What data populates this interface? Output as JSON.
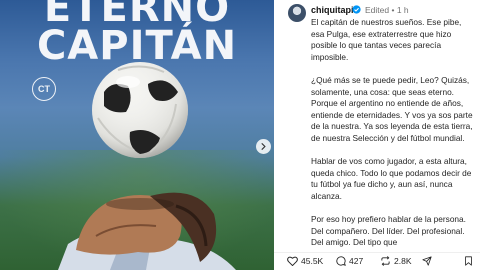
{
  "image": {
    "headline_line1": "ETERNO",
    "headline_line2": "CAPITÁN",
    "badge_text": "CT",
    "next_icon": "chevron-right-icon"
  },
  "post": {
    "username": "chiquitapia",
    "edited_label": "Edited",
    "separator": "•",
    "time": "1 h",
    "paragraphs": [
      "El capitán de nuestros sueños. Ese pibe, esa Pulga, ese extraterrestre que hizo posible lo que tantas veces parecía imposible.",
      "¿Qué más se te puede pedir, Leo? Quizás, solamente, una cosa: que seas eterno. Porque el argentino no entiende de años, entiende de eternidades. Y vos ya sos parte de la nuestra. Ya sos leyenda de esta tierra, de nuestra Selección y del fútbol mundial.",
      "Hablar de vos como jugador, a esta altura, queda chico. Todo lo que podamos decir de tu fútbol ya fue dicho y, aun así, nunca alcanza.",
      "Por eso hoy prefiero hablar de la persona. Del compañero. Del líder. Del profesional. Del amigo. Del tipo que"
    ]
  },
  "actions": {
    "likes": "45.5K",
    "comments": "427",
    "reposts": "2.8K"
  },
  "colors": {
    "verified": "#0095f6",
    "like": "#262626",
    "muted": "#737373"
  }
}
